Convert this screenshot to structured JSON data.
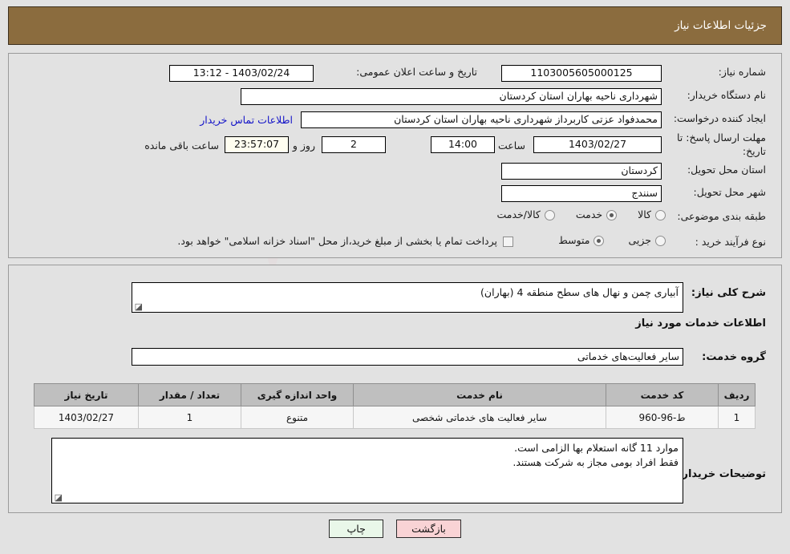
{
  "header": {
    "title": "جزئیات اطلاعات نیاز",
    "brand_color": "#8b6c3e"
  },
  "top_form": {
    "need_number_label": "شماره نیاز:",
    "need_number_value": "1103005605000125",
    "announce_label": "تاریخ و ساعت اعلان عمومی:",
    "announce_value": "1403/02/24 - 13:12",
    "buyer_org_label": "نام دستگاه خریدار:",
    "buyer_org_value": "شهرداری ناحیه بهاران استان کردستان",
    "creator_label": "ایجاد کننده درخواست:",
    "creator_value": "محمدفواد عزتی کاربرداز شهرداری ناحیه بهاران استان کردستان",
    "contact_link": "اطلاعات تماس خریدار",
    "deadline_label": "مهلت ارسال پاسخ: تا تاریخ:",
    "deadline_date": "1403/02/27",
    "hour_label": "ساعت",
    "hour_value": "14:00",
    "days_value": "2",
    "days_label": "روز و",
    "countdown_value": "23:57:07",
    "countdown_label": "ساعت باقی مانده",
    "province_label": "استان محل تحویل:",
    "province_value": "کردستان",
    "city_label": "شهر محل تحویل:",
    "city_value": "سنندج",
    "category_label": "طبقه بندی موضوعی:",
    "category_options": [
      {
        "label": "کالا",
        "selected": false
      },
      {
        "label": "خدمت",
        "selected": true
      },
      {
        "label": "کالا/خدمت",
        "selected": false
      }
    ],
    "process_label": "نوع فرآیند خرید :",
    "process_options": [
      {
        "label": "جزیی",
        "selected": false
      },
      {
        "label": "متوسط",
        "selected": true
      }
    ],
    "treasury_checkbox_label": "پرداخت تمام یا بخشی از مبلغ خرید،از محل \"اسناد خزانه اسلامی\" خواهد بود.",
    "treasury_checked": false
  },
  "need_desc": {
    "label": "شرح کلی نیاز:",
    "value": "آبیاری چمن و نهال های سطح منطقه 4 (بهاران)"
  },
  "services_section": {
    "heading": "اطلاعات خدمات مورد نیاز",
    "group_label": "گروه خدمت:",
    "group_value": "سایر فعالیت‌های خدماتی"
  },
  "table": {
    "headers": [
      "ردیف",
      "کد خدمت",
      "نام خدمت",
      "واحد اندازه گیری",
      "تعداد / مقدار",
      "تاریخ نیاز"
    ],
    "rows": [
      {
        "row_no": "1",
        "service_code": "ط-96-960",
        "service_name": "سایر فعالیت های خدماتی شخصی",
        "unit": "متنوع",
        "quantity": "1",
        "need_date": "1403/02/27"
      }
    ]
  },
  "buyer_notes": {
    "label": "توضیحات خریدار:",
    "lines": [
      "موارد 11 گانه استعلام بها الزامی است.",
      "فقط افراد بومی مجاز به شرکت هستند."
    ]
  },
  "buttons": {
    "print": "چاپ",
    "back": "بازگشت",
    "print_color": "#e9f7e9",
    "back_color": "#f9d3d5"
  }
}
